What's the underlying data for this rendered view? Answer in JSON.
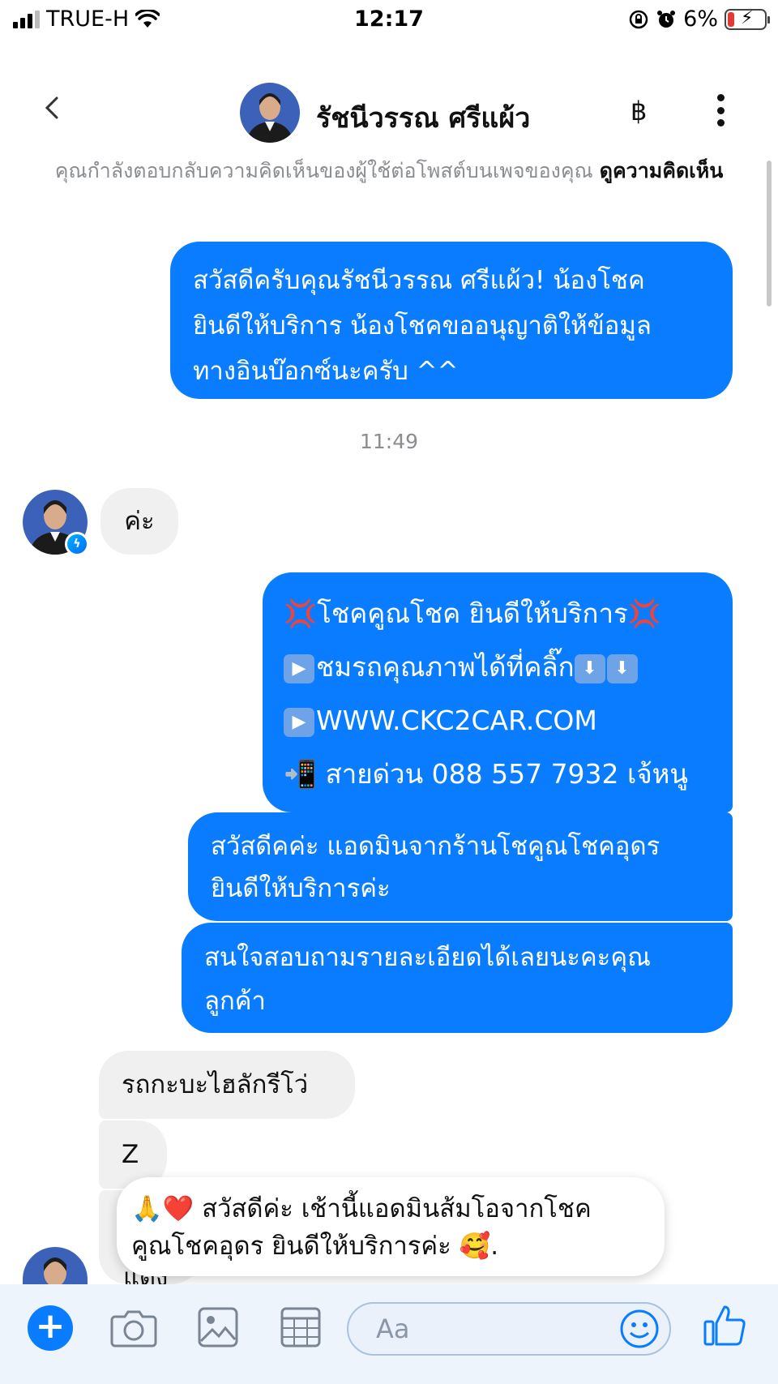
{
  "status_bar": {
    "carrier": "TRUE-H",
    "time": "12:17",
    "battery_percent": "6%",
    "battery_level": 0.06
  },
  "header": {
    "contact_name": "รัชนีวรรณ ศรีแผ้ว",
    "currency_symbol": "฿"
  },
  "notice": {
    "text": "คุณกำลังตอบกลับความคิดเห็นของผู้ใช้ต่อโพสต์บนเพจของคุณ",
    "link": "ดูความคิดเห็น"
  },
  "messages": {
    "m1": {
      "line1": "สวัสดีครับคุณรัชนีวรรณ ศรีแผ้ว! น้องโชค",
      "line2": "ยินดีให้บริการ น้องโชคขออนุญาติให้ข้อมูล",
      "line3": "ทางอินบ๊อกซ์นะครับ ^^"
    },
    "timestamp": "11:49",
    "m2": "ค่ะ",
    "m3": {
      "line1": "โชคคูณโชค ยินดีให้บริการ",
      "line2": "ชมรถคุณภาพได้ที่คลิ๊ก",
      "line3": "WWW.CKC2CAR.COM",
      "line4": "สายด่วน 088 557 7932 เจ้หนู"
    },
    "m4": {
      "line1": "สวัสดีคค่ะ แอดมินจากร้านโชคูณโชคอุดร",
      "line2": "ยินดีให้บริการค่ะ"
    },
    "m5": {
      "line1": "สนใจสอบถามรายละเอียดได้เลยนะคะคุณ",
      "line2": "ลูกค้า"
    },
    "m6": "รถกะบะไฮลักรีโว่",
    "m7": "Z",
    "m8_partial": "แดง"
  },
  "popup": {
    "line1": "สวัสดีค่ะ เช้านี้แอดมินส้มโอจากโชค",
    "line2": "คูณโชคอุดร ยินดีให้บริการค่ะ",
    "line2_end": "."
  },
  "composer": {
    "placeholder": "Aa"
  },
  "icons": {
    "back": "chevron-left-icon",
    "more": "more-vertical-icon",
    "plus": "plus-icon",
    "camera": "camera-icon",
    "gallery": "gallery-icon",
    "grid": "grid-icon",
    "emoji": "smiley-icon",
    "like": "thumbs-up-icon"
  },
  "colors": {
    "outgoing_bubble": "#0a7cff",
    "incoming_bubble": "#f0f0f0",
    "accent": "#0a7cff"
  }
}
